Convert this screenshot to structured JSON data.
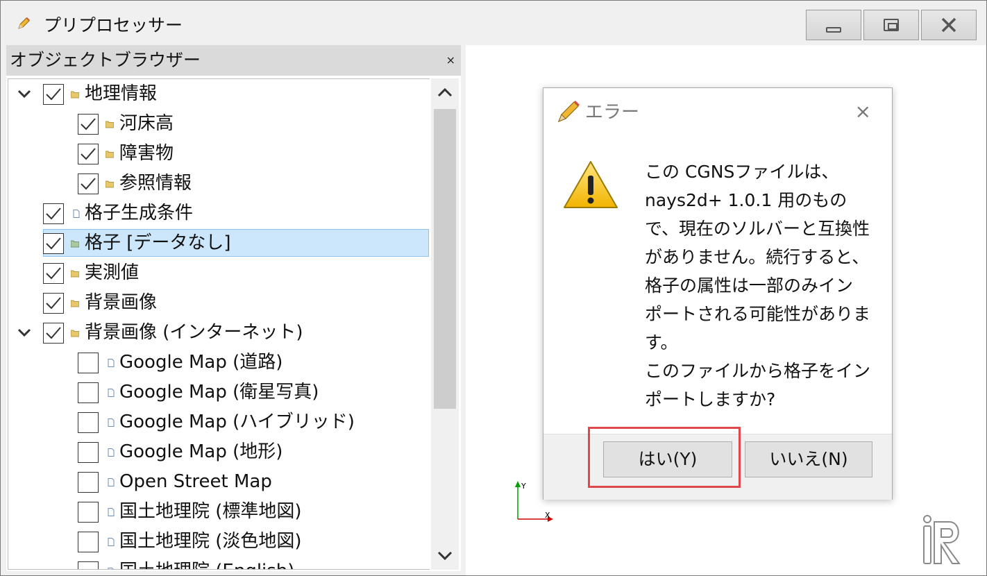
{
  "window": {
    "title": "プリプロセッサー",
    "app_icon": "pencil-icon",
    "controls": [
      "minimize-icon",
      "maximize-icon",
      "close-icon"
    ]
  },
  "object_browser": {
    "title": "オブジェクトブラウザー",
    "close_label": "×",
    "items": [
      {
        "label": "地理情報",
        "checked": true,
        "expanded": true,
        "icon": "folder-icon",
        "level": 0
      },
      {
        "label": "河床高",
        "checked": true,
        "icon": "folder-icon",
        "level": 1
      },
      {
        "label": "障害物",
        "checked": true,
        "icon": "folder-icon",
        "level": 1
      },
      {
        "label": "参照情報",
        "checked": true,
        "icon": "folder-icon",
        "level": 1
      },
      {
        "label": "格子生成条件",
        "checked": true,
        "icon": "document-icon",
        "level": 0
      },
      {
        "label": "格子 [データなし]",
        "checked": true,
        "icon": "grid-folder-icon",
        "level": 0,
        "selected": true
      },
      {
        "label": "実測値",
        "checked": true,
        "icon": "folder-icon",
        "level": 0
      },
      {
        "label": "背景画像",
        "checked": true,
        "icon": "folder-icon",
        "level": 0
      },
      {
        "label": "背景画像 (インターネット)",
        "checked": true,
        "expanded": true,
        "icon": "folder-icon",
        "level": 0
      },
      {
        "label": "Google Map (道路)",
        "checked": false,
        "icon": "document-icon",
        "level": 1
      },
      {
        "label": "Google Map (衛星写真)",
        "checked": false,
        "icon": "document-icon",
        "level": 1
      },
      {
        "label": "Google Map (ハイブリッド)",
        "checked": false,
        "icon": "document-icon",
        "level": 1
      },
      {
        "label": "Google Map (地形)",
        "checked": false,
        "icon": "document-icon",
        "level": 1
      },
      {
        "label": "Open Street Map",
        "checked": false,
        "icon": "document-icon",
        "level": 1
      },
      {
        "label": "国土地理院 (標準地図)",
        "checked": false,
        "icon": "document-icon",
        "level": 1
      },
      {
        "label": "国土地理院 (淡色地図)",
        "checked": false,
        "icon": "document-icon",
        "level": 1
      },
      {
        "label": "国土地理院 (English)",
        "checked": false,
        "icon": "document-icon",
        "level": 1
      }
    ]
  },
  "canvas": {
    "axis_x": "X",
    "axis_y": "Y",
    "x_color": "#cc0000",
    "y_color": "#00a000"
  },
  "dialog": {
    "title": "エラー",
    "close_label": "×",
    "message": "この CGNSファイルは、\nnays2d+ 1.0.1 用のもの\nで、現在のソルバーと互換性\nがありません。続行すると、\n格子の属性は一部のみイン\nポートされる可能性がありま\nす。\nこのファイルから格子をイン\nポートしますか?",
    "yes_label": "はい(Y)",
    "no_label": "いいえ(N)"
  },
  "colors": {
    "selection": "#cce6fb",
    "highlight_box": "#e0474c",
    "folder": "#e8c76a"
  }
}
